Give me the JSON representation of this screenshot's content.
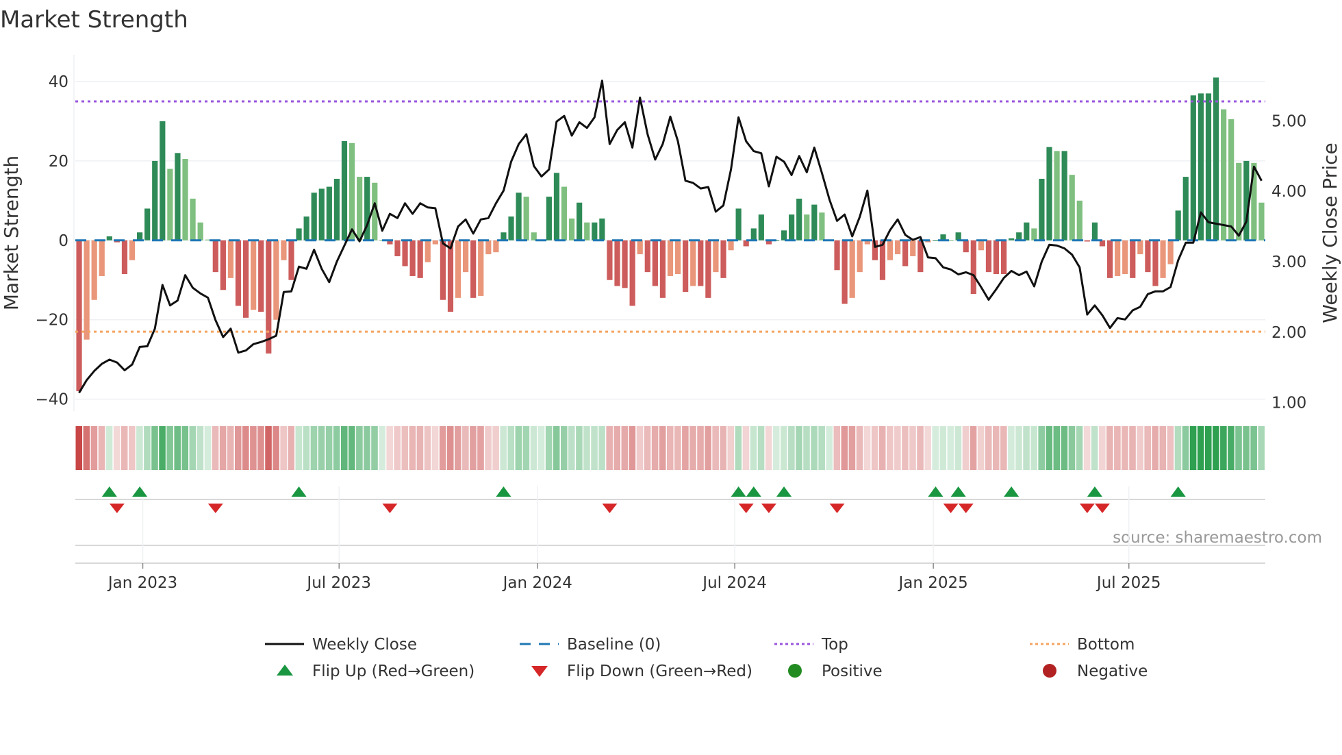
{
  "chart_data": {
    "type": "bar",
    "title": "Market Strength",
    "ylabel": "Market Strength",
    "y2label": "Weekly Close Price",
    "ylim": [
      -43,
      45
    ],
    "y2lim": [
      0.88,
      5.84
    ],
    "yticks": [
      -40,
      -20,
      0,
      20,
      40
    ],
    "yticklabels": [
      "−40",
      "−20",
      "0",
      "20",
      "40"
    ],
    "y2ticks": [
      1,
      2,
      3,
      4,
      5
    ],
    "y2ticklabels": [
      "1.00",
      "2.00",
      "3.00",
      "4.00",
      "5.00"
    ],
    "x_start": "2022-11-04",
    "x_end": "2025-10-31",
    "xticks": [
      {
        "label": "Jan 2023",
        "week": 8.4
      },
      {
        "label": "Jul 2023",
        "week": 34.3
      },
      {
        "label": "Jan 2024",
        "week": 60.5
      },
      {
        "label": "Jul 2024",
        "week": 86.5
      },
      {
        "label": "Jan 2025",
        "week": 112.7
      },
      {
        "label": "Jul 2025",
        "week": 138.5
      }
    ],
    "top_level": 35,
    "bottom_level": -23,
    "baseline": 0,
    "strength": [
      -38,
      -25,
      -15,
      -9,
      1,
      -0.5,
      -8.5,
      -5,
      2,
      8,
      20,
      30,
      18,
      22,
      20.5,
      10.5,
      4.5,
      0.2,
      -8,
      -12.5,
      -9.5,
      -16.5,
      -19.5,
      -17.5,
      -18,
      -28.5,
      -20,
      -5,
      -10,
      3,
      6,
      12,
      13,
      13.5,
      15.5,
      25,
      24.5,
      16,
      16,
      14.5,
      0,
      -1,
      -4,
      -6.5,
      -9,
      -9.5,
      -5.5,
      -1,
      -15,
      -18,
      -14.5,
      -8,
      -14.5,
      -14,
      -3.5,
      -3,
      2,
      6,
      12,
      11,
      2,
      0.2,
      11,
      17,
      13.5,
      5.5,
      9.5,
      4.5,
      4.5,
      5.5,
      -10,
      -11.5,
      -12,
      -16.5,
      -3.5,
      -8,
      -11.5,
      -14.5,
      -9,
      -8.5,
      -13,
      -11.5,
      -11.5,
      -14.5,
      -8,
      -9.5,
      -2.5,
      8,
      -1.5,
      3,
      6.5,
      -1,
      0,
      2.5,
      6.5,
      10.5,
      6.5,
      9,
      7,
      0.2,
      -7.5,
      -16,
      -14.5,
      -8,
      -1,
      -5,
      -10,
      -5,
      -3.5,
      -6.5,
      -4,
      -8,
      -0.5,
      0,
      1.5,
      0,
      2,
      -3,
      -13.5,
      -2.5,
      -8,
      -8.5,
      -8.5,
      0.5,
      2,
      4.5,
      3,
      15.5,
      23.5,
      22.5,
      22.5,
      16.5,
      10,
      -0.3,
      4.5,
      -1.5,
      -9.5,
      -9,
      -8.5,
      -9.5,
      -3.5,
      -8,
      -11.5,
      -9.5,
      -6,
      7.5,
      16,
      36.5,
      37,
      37,
      41,
      33,
      30.5,
      19.5,
      20,
      19.5,
      9.5
    ],
    "weekly_close": [
      1.14,
      1.32,
      1.45,
      1.55,
      1.61,
      1.57,
      1.46,
      1.54,
      1.79,
      1.8,
      2.05,
      2.67,
      2.38,
      2.45,
      2.81,
      2.63,
      2.55,
      2.49,
      2.17,
      1.93,
      2.05,
      1.71,
      1.74,
      1.83,
      1.86,
      1.9,
      1.95,
      2.57,
      2.58,
      2.93,
      2.9,
      3.17,
      2.9,
      2.71,
      3.0,
      3.23,
      3.46,
      3.29,
      3.52,
      3.83,
      3.44,
      3.68,
      3.62,
      3.83,
      3.68,
      3.83,
      3.77,
      3.76,
      3.26,
      3.19,
      3.5,
      3.6,
      3.4,
      3.6,
      3.62,
      3.83,
      4.01,
      4.42,
      4.67,
      4.81,
      4.36,
      4.21,
      4.31,
      4.99,
      5.07,
      4.79,
      4.98,
      4.9,
      5.05,
      5.57,
      4.67,
      4.87,
      4.98,
      4.62,
      5.33,
      4.81,
      4.45,
      4.67,
      5.06,
      4.71,
      4.15,
      4.12,
      4.04,
      4.06,
      3.71,
      3.8,
      4.31,
      5.05,
      4.71,
      4.57,
      4.54,
      4.07,
      4.49,
      4.42,
      4.23,
      4.5,
      4.27,
      4.62,
      4.26,
      3.88,
      3.58,
      3.67,
      3.36,
      3.64,
      4.01,
      3.21,
      3.24,
      3.45,
      3.6,
      3.38,
      3.31,
      3.35,
      3.06,
      3.05,
      2.92,
      2.89,
      2.82,
      2.85,
      2.81,
      2.64,
      2.46,
      2.61,
      2.77,
      2.87,
      2.81,
      2.86,
      2.65,
      3.0,
      3.24,
      3.23,
      3.19,
      3.1,
      2.92,
      2.25,
      2.38,
      2.24,
      2.06,
      2.2,
      2.18,
      2.31,
      2.36,
      2.54,
      2.58,
      2.58,
      2.64,
      3.02,
      3.27,
      3.27,
      3.7,
      3.56,
      3.54,
      3.52,
      3.5,
      3.37,
      3.57,
      4.35,
      4.15
    ],
    "flip_up_weeks": [
      4,
      8,
      29,
      56,
      87,
      89,
      93,
      113,
      116,
      123,
      134,
      145
    ],
    "flip_down_weeks": [
      5,
      18,
      41,
      70,
      88,
      91,
      100,
      115,
      117,
      133,
      135
    ],
    "legend": {
      "placement": "bottom",
      "items": [
        {
          "label": "Weekly Close",
          "kind": "line"
        },
        {
          "label": "Baseline (0)",
          "kind": "dash"
        },
        {
          "label": "Top",
          "kind": "dot-purple"
        },
        {
          "label": "Bottom",
          "kind": "dot-orange"
        },
        {
          "label": "Flip Up (Red→Green)",
          "kind": "tri-up"
        },
        {
          "label": "Flip Down (Green→Red)",
          "kind": "tri-down"
        },
        {
          "label": "Positive",
          "kind": "circle-green"
        },
        {
          "label": "Negative",
          "kind": "circle-red"
        }
      ]
    },
    "annotation": "source: sharemaestro.com"
  },
  "colors": {
    "pos_rising": "#2e8b57",
    "pos_falling": "#7fbf7f",
    "neg_falling": "#cd5c5c",
    "neg_rising": "#e9967a",
    "line": "#111111",
    "top": "#9955dd",
    "bottom": "#f4a460",
    "baseline": "#1f77b4",
    "flip_up": "#1a9641",
    "flip_down": "#d62728",
    "positive": "#228b22",
    "negative": "#b22222"
  }
}
